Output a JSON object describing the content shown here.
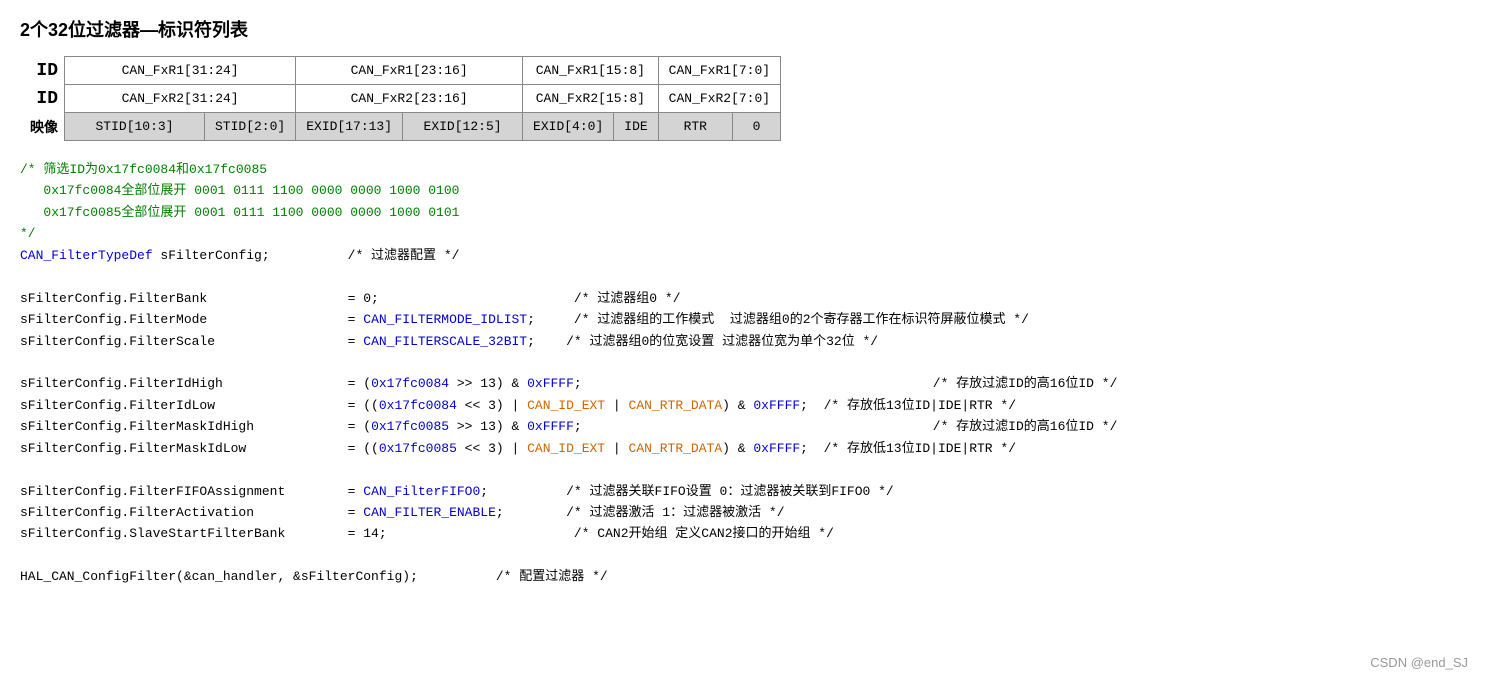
{
  "title": {
    "prefix": "2个",
    "bold": "32位过滤器",
    "suffix": "—标识符列表"
  },
  "table": {
    "row1_label": "ID",
    "row2_label": "ID",
    "row3_label": "映像",
    "row1_cells": [
      "CAN_FxR1[31:24]",
      "CAN_FxR1[23:16]",
      "CAN_FxR1[15:8]",
      "CAN_FxR1[7:0]"
    ],
    "row2_cells": [
      "CAN_FxR2[31:24]",
      "CAN_FxR2[23:16]",
      "CAN_FxR2[15:8]",
      "CAN_FxR2[7:0]"
    ],
    "row3_cells": [
      "STID[10:3]",
      "STID[2:0]",
      "EXID[17:13]",
      "EXID[12:5]",
      "EXID[4:0]",
      "IDE",
      "RTR",
      "0"
    ]
  },
  "code": {
    "comment_block": [
      "/* 筛选ID为0x17fc0084和0x17fc0085",
      "   0x17fc0084全部位展开 0001 0111 1100 0000 0000 1000 0100",
      "   0x17fc0085全部位展开 0001 0111 1100 0000 0000 1000 0101",
      "*/"
    ],
    "typedef_line": "CAN_FilterTypeDef sFilterConfig;",
    "typedef_comment": "/* 过滤器配置 */",
    "assignments": [
      {
        "var": "sFilterConfig.FilterBank",
        "val": "= 0;",
        "comment": "/* 过滤器组0 */"
      },
      {
        "var": "sFilterConfig.FilterMode",
        "val": "= CAN_FILTERMODE_IDLIST;",
        "comment": "/* 过滤器组的工作模式  过滤器组0的2个寄存器工作在标识符屏蔽位模式 */"
      },
      {
        "var": "sFilterConfig.FilterScale",
        "val": "= CAN_FILTERSCALE_32BIT;",
        "comment": "/* 过滤器组0的位宽设置 过滤器位宽为单个32位 */"
      }
    ],
    "id_assignments": [
      {
        "var": "sFilterConfig.FilterIdHigh",
        "val": "= (0x17fc0084 >> 13) & 0xFFFF;",
        "comment": "/* 存放过滤ID的高16位ID */"
      },
      {
        "var": "sFilterConfig.FilterIdLow",
        "val": "= ((0x17fc0084 << 3) | CAN_ID_EXT | CAN_RTR_DATA) & 0xFFFF;",
        "comment": "/* 存放低13位ID|IDE|RTR */"
      },
      {
        "var": "sFilterConfig.FilterMaskIdHigh",
        "val": "= (0x17fc0085 >> 13) & 0xFFFF;",
        "comment": "/* 存放过滤ID的高16位ID */"
      },
      {
        "var": "sFilterConfig.FilterMaskIdLow",
        "val": "= ((0x17fc0085 << 3) | CAN_ID_EXT | CAN_RTR_DATA) & 0xFFFF;",
        "comment": "/* 存放低13位ID|IDE|RTR */"
      }
    ],
    "fifo_assignments": [
      {
        "var": "sFilterConfig.FilterFIFOAssignment",
        "val": "= CAN_FilterFIFO0;",
        "comment": "/* 过滤器关联FIFO设置 0：过滤器被关联到FIFO0 */"
      },
      {
        "var": "sFilterConfig.FilterActivation",
        "val": "= CAN_FILTER_ENABLE;",
        "comment": "/* 过滤器激活 1：过滤器被激活 */"
      },
      {
        "var": "sFilterConfig.SlaveStartFilterBank",
        "val": "= 14;",
        "comment": "/* CAN2开始组 定义CAN2接口的开始组 */"
      }
    ],
    "final_call": "HAL_CAN_ConfigFilter(&can_handler, &sFilterConfig);",
    "final_comment": "/* 配置过滤器 */",
    "watermark": "CSDN @end_SJ"
  }
}
